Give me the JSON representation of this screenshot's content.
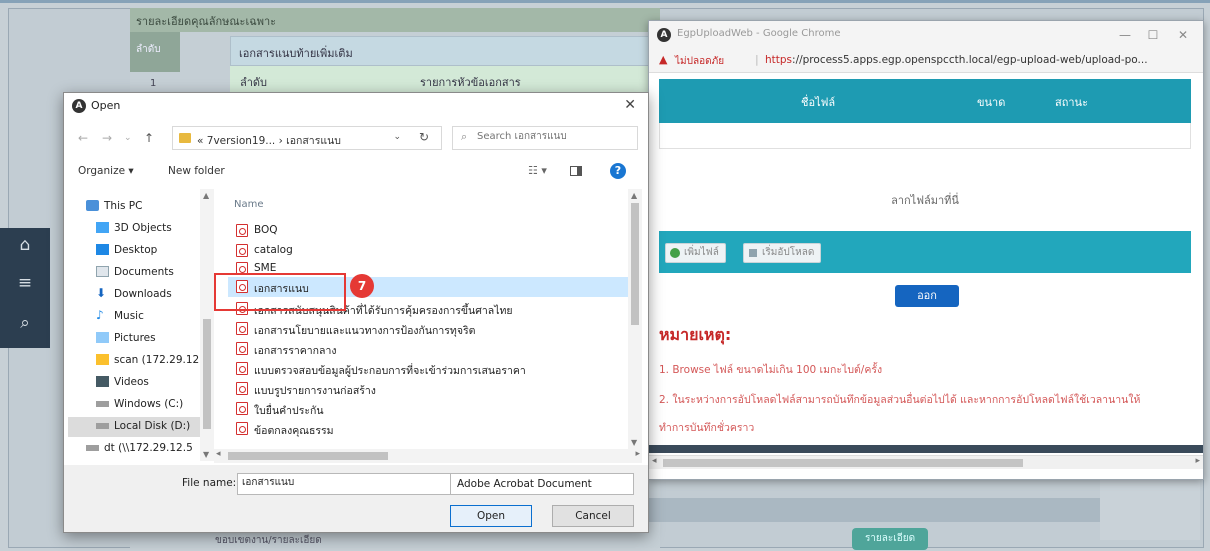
{
  "background": {
    "detail_header": "รายละเอียดคุณลักษณะเฉพาะ",
    "col_order": "ลำดับ",
    "row1": "1",
    "attach_header": "เอกสารแนบท้ายเพิ่มเติม",
    "attach_col_order": "ลำดับ",
    "attach_col_list": "รายการหัวข้อเอกสาร",
    "detail_button": "รายละเอียด",
    "bottom_text": "ขอบเขตงาน/รายละเอียด"
  },
  "chrome": {
    "title": "EgpUploadWeb - Google Chrome",
    "insecure_label": "ไม่ปลอดภัย",
    "url_scheme": "https",
    "url_rest": "://process5.apps.egp.openspccth.local/egp-upload-web/upload-po...",
    "table_cols": [
      "ชื่อไฟล์",
      "ขนาด",
      "สถานะ"
    ],
    "drop_text": "ลากไฟล์มาที่นี่",
    "add_file_label": "เพิ่มไฟล์",
    "start_upload_label": "เริ่มอัปโหลด",
    "exit_label": "ออก",
    "note_title": "หมายเหตุ:",
    "notes": [
      "1. Browse ไฟล์ ขนาดไม่เกิน 100 เมกะไบต์/ครั้ง",
      "2. ในระหว่างการอัปโหลดไฟล์สามารถบันทึกข้อมูลส่วนอื่นต่อไปได้ และหากการอัปโหลดไฟล์ใช้เวลานานให้",
      "ทำการบันทึกชั่วคราว"
    ]
  },
  "dialog": {
    "title": "Open",
    "path": "« 7version19... › เอกสารแนบ",
    "search_placeholder": "Search เอกสารแนบ",
    "organize_label": "Organize ▾",
    "new_folder_label": "New folder",
    "column_name": "Name",
    "tree": [
      {
        "label": "This PC",
        "icon": "pc-icon"
      },
      {
        "label": "3D Objects",
        "icon": "3d-objects-icon"
      },
      {
        "label": "Desktop",
        "icon": "desktop-icon"
      },
      {
        "label": "Documents",
        "icon": "documents-icon"
      },
      {
        "label": "Downloads",
        "icon": "downloads-icon"
      },
      {
        "label": "Music",
        "icon": "music-icon"
      },
      {
        "label": "Pictures",
        "icon": "pictures-icon"
      },
      {
        "label": "scan (172.29.12.1",
        "icon": "network-drive-icon"
      },
      {
        "label": "Videos",
        "icon": "videos-icon"
      },
      {
        "label": "Windows (C:)",
        "icon": "drive-icon"
      },
      {
        "label": "Local Disk (D:)",
        "icon": "drive-icon"
      },
      {
        "label": "dt (\\\\172.29.12.5",
        "icon": "network-drive-icon"
      }
    ],
    "files": [
      "BOQ",
      "catalog",
      "SME",
      "เอกสารแนบ",
      "เอกสารสนับสนุนสินค้าที่ได้รับการคุ้มครองการขึ้นศาลไทย",
      "เอกสารนโยบายและแนวทางการป้องกันการทุจริต",
      "เอกสารราคากลาง",
      "แบบตรวจสอบข้อมูลผู้ประกอบการที่จะเข้าร่วมการเสนอราคา",
      "แบบรูปรายการงานก่อสร้าง",
      "ใบยื่นคำประกัน",
      "ข้อตกลงคุณธรรม"
    ],
    "file_name_label": "File name:",
    "file_name_value": "เอกสารแนบ",
    "file_type": "Adobe Acrobat Document",
    "open_label": "Open",
    "cancel_label": "Cancel"
  },
  "annotation": {
    "step": "7",
    "color": "#e53935"
  }
}
